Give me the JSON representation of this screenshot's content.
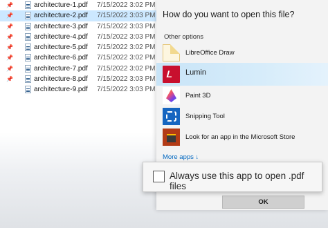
{
  "files": [
    {
      "name": "architecture-1.pdf",
      "date": "7/15/2022 3:02 PM",
      "pinned": true,
      "selected": false
    },
    {
      "name": "architecture-2.pdf",
      "date": "7/15/2022 3:03 PM",
      "pinned": true,
      "selected": true
    },
    {
      "name": "architecture-3.pdf",
      "date": "7/15/2022 3:03 PM",
      "pinned": true,
      "selected": false
    },
    {
      "name": "architecture-4.pdf",
      "date": "7/15/2022 3:03 PM",
      "pinned": true,
      "selected": false
    },
    {
      "name": "architecture-5.pdf",
      "date": "7/15/2022 3:02 PM",
      "pinned": true,
      "selected": false
    },
    {
      "name": "architecture-6.pdf",
      "date": "7/15/2022 3:02 PM",
      "pinned": true,
      "selected": false
    },
    {
      "name": "architecture-7.pdf",
      "date": "7/15/2022 3:02 PM",
      "pinned": true,
      "selected": false
    },
    {
      "name": "architecture-8.pdf",
      "date": "7/15/2022 3:03 PM",
      "pinned": true,
      "selected": false
    },
    {
      "name": "architecture-9.pdf",
      "date": "7/15/2022 3:03 PM",
      "pinned": false,
      "selected": false
    }
  ],
  "dialog": {
    "title": "How do you want to open this file?",
    "section_label": "Other options",
    "apps": [
      {
        "name": "LibreOffice Draw",
        "icon": "libreoffice-draw-icon"
      },
      {
        "name": "Lumin",
        "icon": "lumin-icon",
        "highlighted": true
      },
      {
        "name": "Paint 3D",
        "icon": "paint-3d-icon"
      },
      {
        "name": "Snipping Tool",
        "icon": "snipping-tool-icon"
      },
      {
        "name": "Look for an app in the Microsoft Store",
        "icon": "microsoft-store-icon"
      }
    ],
    "more_apps": "More apps ↓",
    "always_use_label": "Always use this app to open .pdf files",
    "always_use_checked": false,
    "ok_label": "OK"
  },
  "colors": {
    "selection": "#cce8ff",
    "highlight": "#d6ecfa",
    "link": "#0067c0",
    "lumin_red": "#c8102e"
  }
}
